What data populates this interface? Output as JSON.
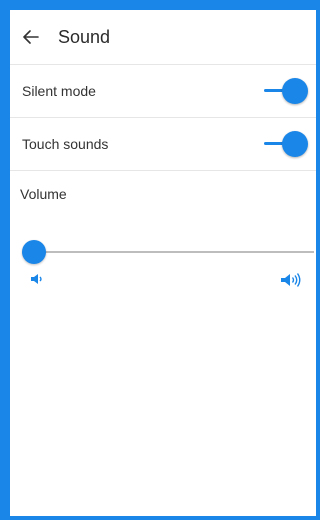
{
  "header": {
    "back_icon": "arrow-left-icon",
    "title": "Sound"
  },
  "settings": {
    "silent_mode": {
      "label": "Silent mode",
      "on": true
    },
    "touch_sounds": {
      "label": "Touch sounds",
      "on": true
    }
  },
  "volume": {
    "label": "Volume",
    "level_percent": 0,
    "min_icon": "volume-low-icon",
    "max_icon": "volume-high-icon"
  },
  "colors": {
    "accent": "#1a86e8",
    "frame": "#1a86e8"
  }
}
